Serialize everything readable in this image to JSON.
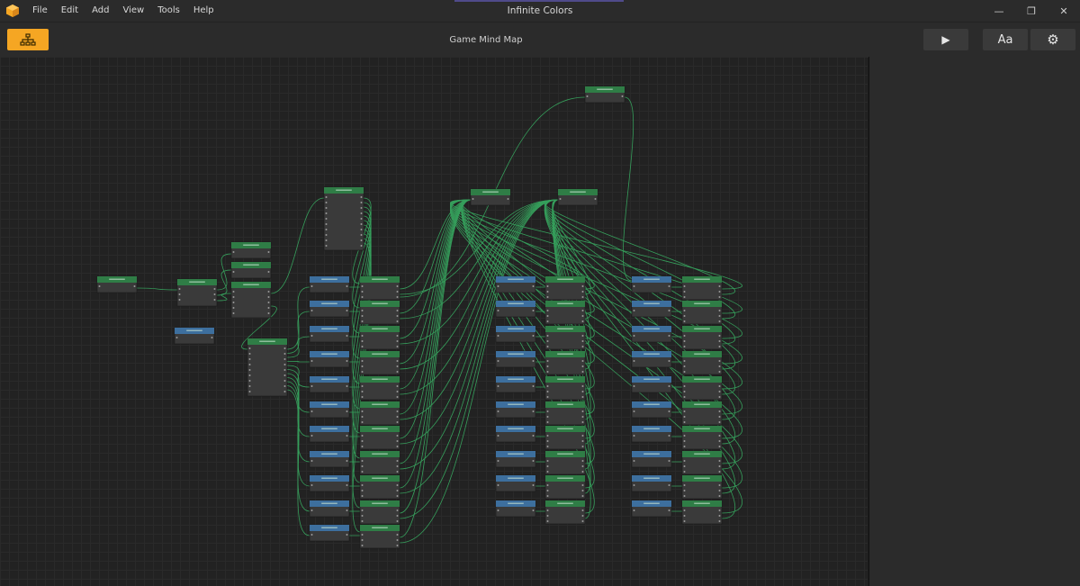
{
  "window": {
    "title": "Infinite Colors",
    "minimize": "—",
    "maximize": "❐",
    "close": "✕"
  },
  "menu": [
    "File",
    "Edit",
    "Add",
    "View",
    "Tools",
    "Help"
  ],
  "toolbar": {
    "page_title": "Game Mind Map",
    "play_icon": "▶",
    "font_label": "Aa",
    "settings_icon": "⚙"
  },
  "colors": {
    "accent": "#f5a623",
    "scene_header": "#2f7d46",
    "level_header": "#3d6f9e",
    "node_body": "#3a3a3a",
    "wire": "#3cc86e"
  }
}
